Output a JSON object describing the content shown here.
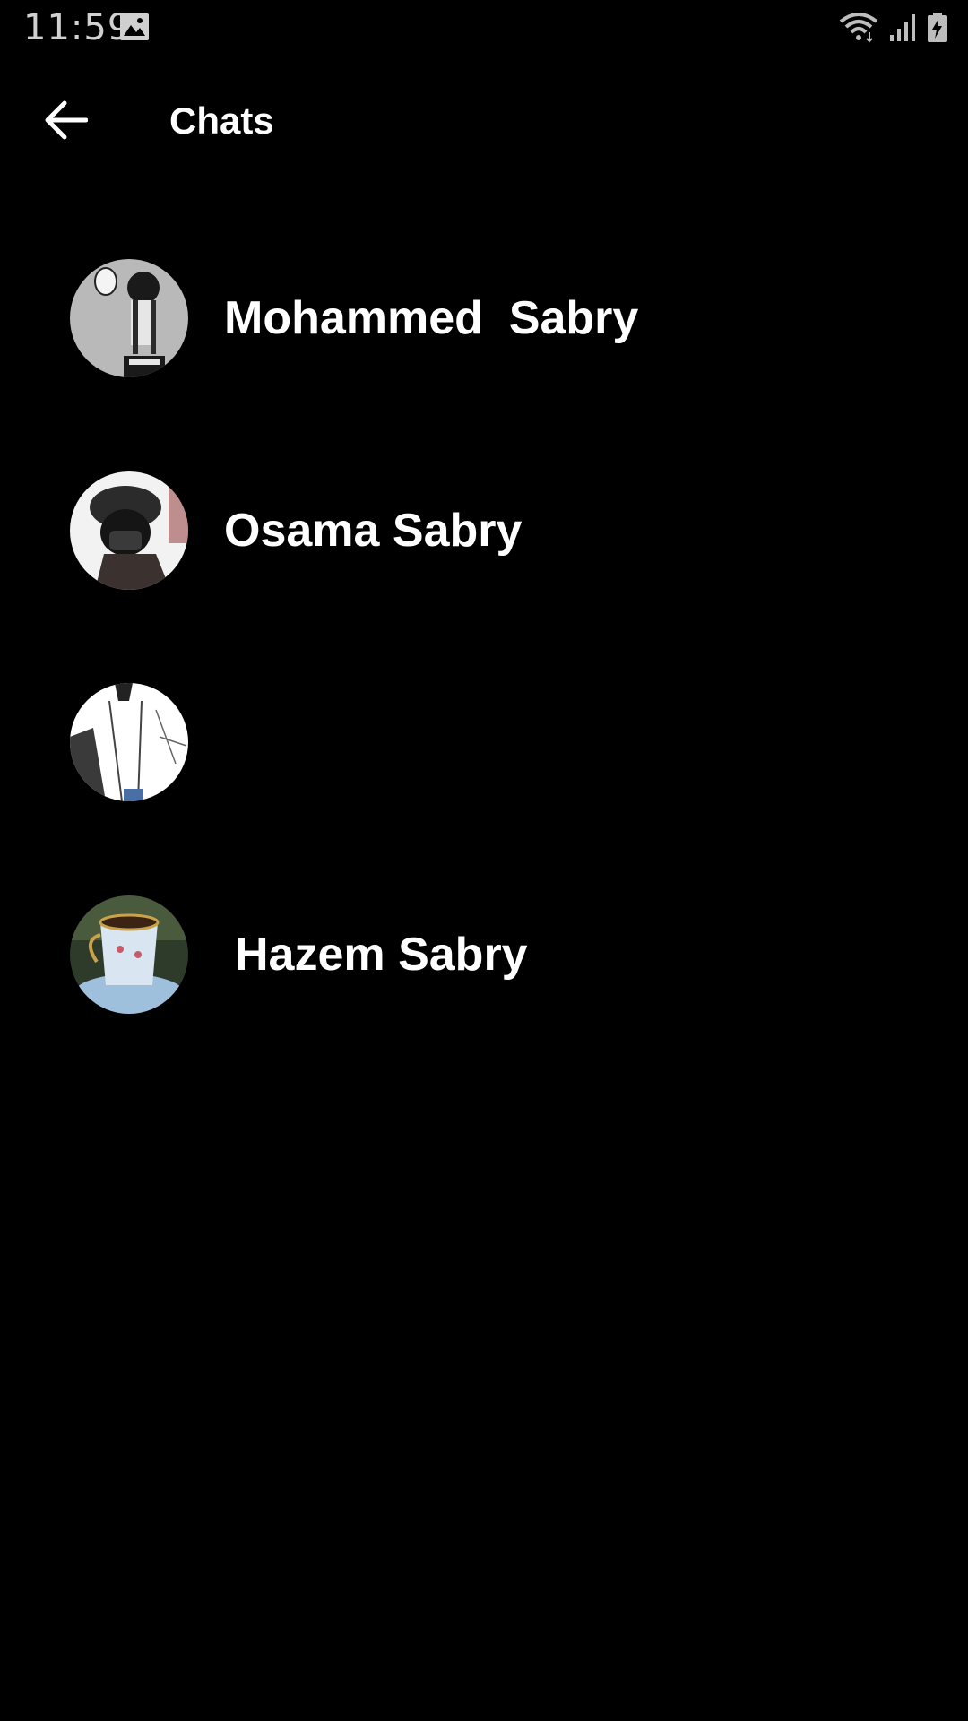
{
  "status_bar": {
    "time": "11:59",
    "icons": [
      "gallery-icon",
      "wifi-icon",
      "signal-icon",
      "battery-charging-icon"
    ]
  },
  "app_bar": {
    "back_icon": "arrow-back-icon",
    "title": "Chats"
  },
  "chats": [
    {
      "name": "Mohammed  Sabry",
      "avatar": "anime-boy-avatar"
    },
    {
      "name": "Osama Sabry",
      "avatar": "masked-figure-avatar"
    },
    {
      "name": "",
      "avatar": "sketch-person-avatar"
    },
    {
      "name": "Hazem Sabry",
      "avatar": "teacup-avatar"
    }
  ],
  "colors": {
    "background": "#000000",
    "text": "#ffffff",
    "status_text": "#d0d0d0"
  }
}
